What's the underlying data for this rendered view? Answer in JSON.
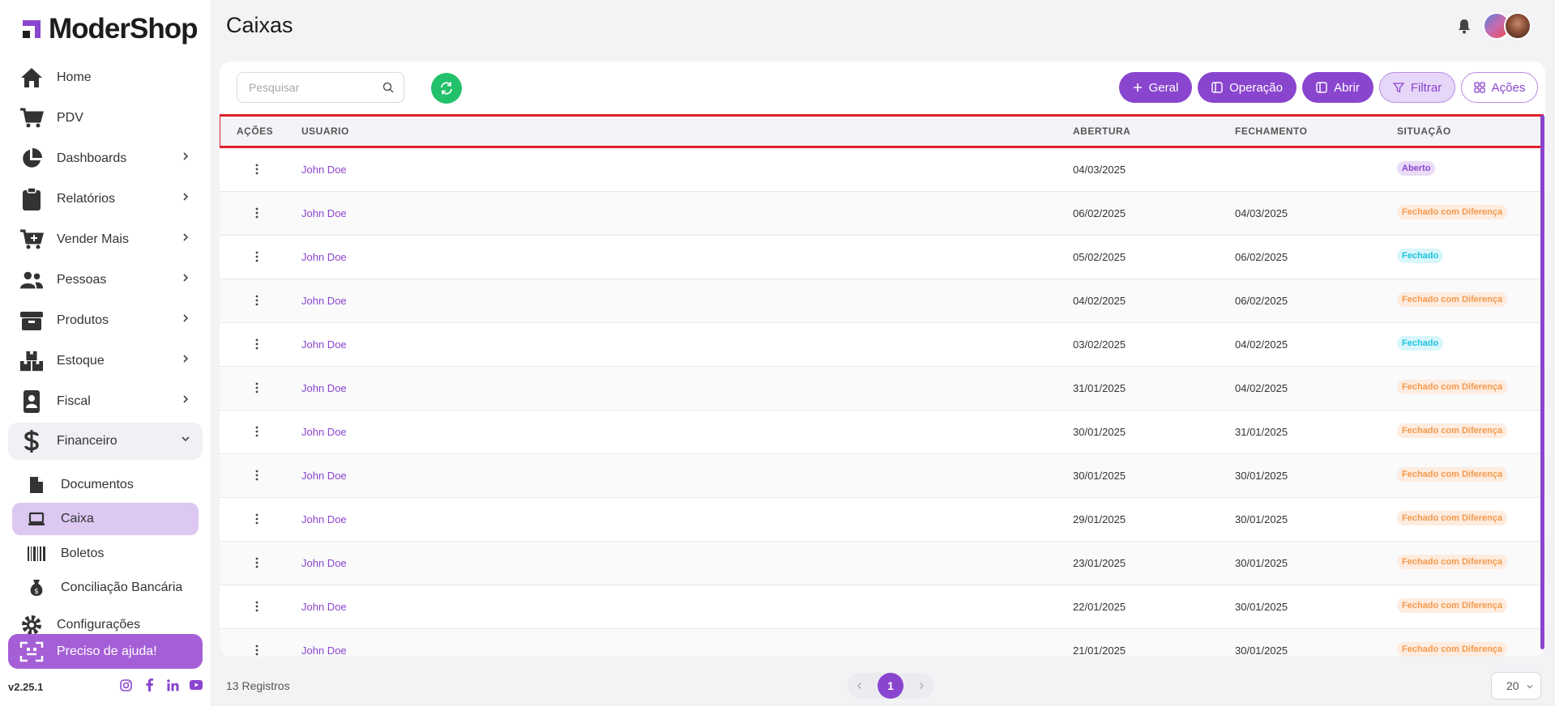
{
  "app": {
    "logo_text": "ModerShop",
    "version": "v2.25.1"
  },
  "sidebar": {
    "items": [
      {
        "label": "Home",
        "icon": "home-icon"
      },
      {
        "label": "PDV",
        "icon": "cart-icon"
      },
      {
        "label": "Dashboards",
        "icon": "pie-chart-icon",
        "expandable": true
      },
      {
        "label": "Relatórios",
        "icon": "clipboard-icon",
        "expandable": true
      },
      {
        "label": "Vender Mais",
        "icon": "cart-plus-icon",
        "expandable": true
      },
      {
        "label": "Pessoas",
        "icon": "users-icon",
        "expandable": true
      },
      {
        "label": "Produtos",
        "icon": "box-icon",
        "expandable": true
      },
      {
        "label": "Estoque",
        "icon": "boxes-icon",
        "expandable": true
      },
      {
        "label": "Fiscal",
        "icon": "badge-icon",
        "expandable": true
      },
      {
        "label": "Financeiro",
        "icon": "dollar-icon",
        "expandable": true,
        "expanded": true
      }
    ],
    "sub_items": [
      {
        "label": "Documentos",
        "icon": "document-icon"
      },
      {
        "label": "Caixa",
        "icon": "laptop-icon",
        "active": true
      },
      {
        "label": "Boletos",
        "icon": "barcode-icon"
      },
      {
        "label": "Conciliação Bancária",
        "icon": "money-bag-icon"
      }
    ],
    "settings_label": "Configurações",
    "help_label": "Preciso de ajuda!"
  },
  "header": {
    "title": "Caixas"
  },
  "toolbar": {
    "search_placeholder": "Pesquisar",
    "buttons": {
      "geral": "Geral",
      "operacao": "Operação",
      "abrir": "Abrir",
      "filtrar": "Filtrar",
      "acoes": "Ações"
    }
  },
  "table": {
    "headers": {
      "acoes": "AÇÕES",
      "usuario": "USUARIO",
      "abertura": "ABERTURA",
      "fechamento": "FECHAMENTO",
      "situacao": "SITUAÇÃO"
    },
    "rows": [
      {
        "usuario": "John Doe",
        "abertura": "04/03/2025",
        "fechamento": "",
        "situacao": "Aberto",
        "status": "open"
      },
      {
        "usuario": "John Doe",
        "abertura": "06/02/2025",
        "fechamento": "04/03/2025",
        "situacao": "Fechado com Diferença",
        "status": "diff"
      },
      {
        "usuario": "John Doe",
        "abertura": "05/02/2025",
        "fechamento": "06/02/2025",
        "situacao": "Fechado",
        "status": "closed"
      },
      {
        "usuario": "John Doe",
        "abertura": "04/02/2025",
        "fechamento": "06/02/2025",
        "situacao": "Fechado com Diferença",
        "status": "diff"
      },
      {
        "usuario": "John Doe",
        "abertura": "03/02/2025",
        "fechamento": "04/02/2025",
        "situacao": "Fechado",
        "status": "closed"
      },
      {
        "usuario": "John Doe",
        "abertura": "31/01/2025",
        "fechamento": "04/02/2025",
        "situacao": "Fechado com Diferença",
        "status": "diff"
      },
      {
        "usuario": "John Doe",
        "abertura": "30/01/2025",
        "fechamento": "31/01/2025",
        "situacao": "Fechado com Diferença",
        "status": "diff"
      },
      {
        "usuario": "John Doe",
        "abertura": "30/01/2025",
        "fechamento": "30/01/2025",
        "situacao": "Fechado com Diferença",
        "status": "diff"
      },
      {
        "usuario": "John Doe",
        "abertura": "29/01/2025",
        "fechamento": "30/01/2025",
        "situacao": "Fechado com Diferença",
        "status": "diff"
      },
      {
        "usuario": "John Doe",
        "abertura": "23/01/2025",
        "fechamento": "30/01/2025",
        "situacao": "Fechado com Diferença",
        "status": "diff"
      },
      {
        "usuario": "John Doe",
        "abertura": "22/01/2025",
        "fechamento": "30/01/2025",
        "situacao": "Fechado com Diferença",
        "status": "diff"
      },
      {
        "usuario": "John Doe",
        "abertura": "21/01/2025",
        "fechamento": "30/01/2025",
        "situacao": "Fechado com Diferença",
        "status": "diff"
      }
    ]
  },
  "footer": {
    "records": "13 Registros",
    "page": "1",
    "per_page": "20"
  },
  "colors": {
    "accent": "#8a45cf",
    "refresh": "#23c16b",
    "highlight": "#e0202a",
    "badge_open_bg": "#eadcf7",
    "badge_open_fg": "#8a45cf",
    "badge_diff_bg": "#fdecdf",
    "badge_diff_fg": "#f59a4e",
    "badge_closed_bg": "#d9f6fb",
    "badge_closed_fg": "#1cc4de"
  }
}
